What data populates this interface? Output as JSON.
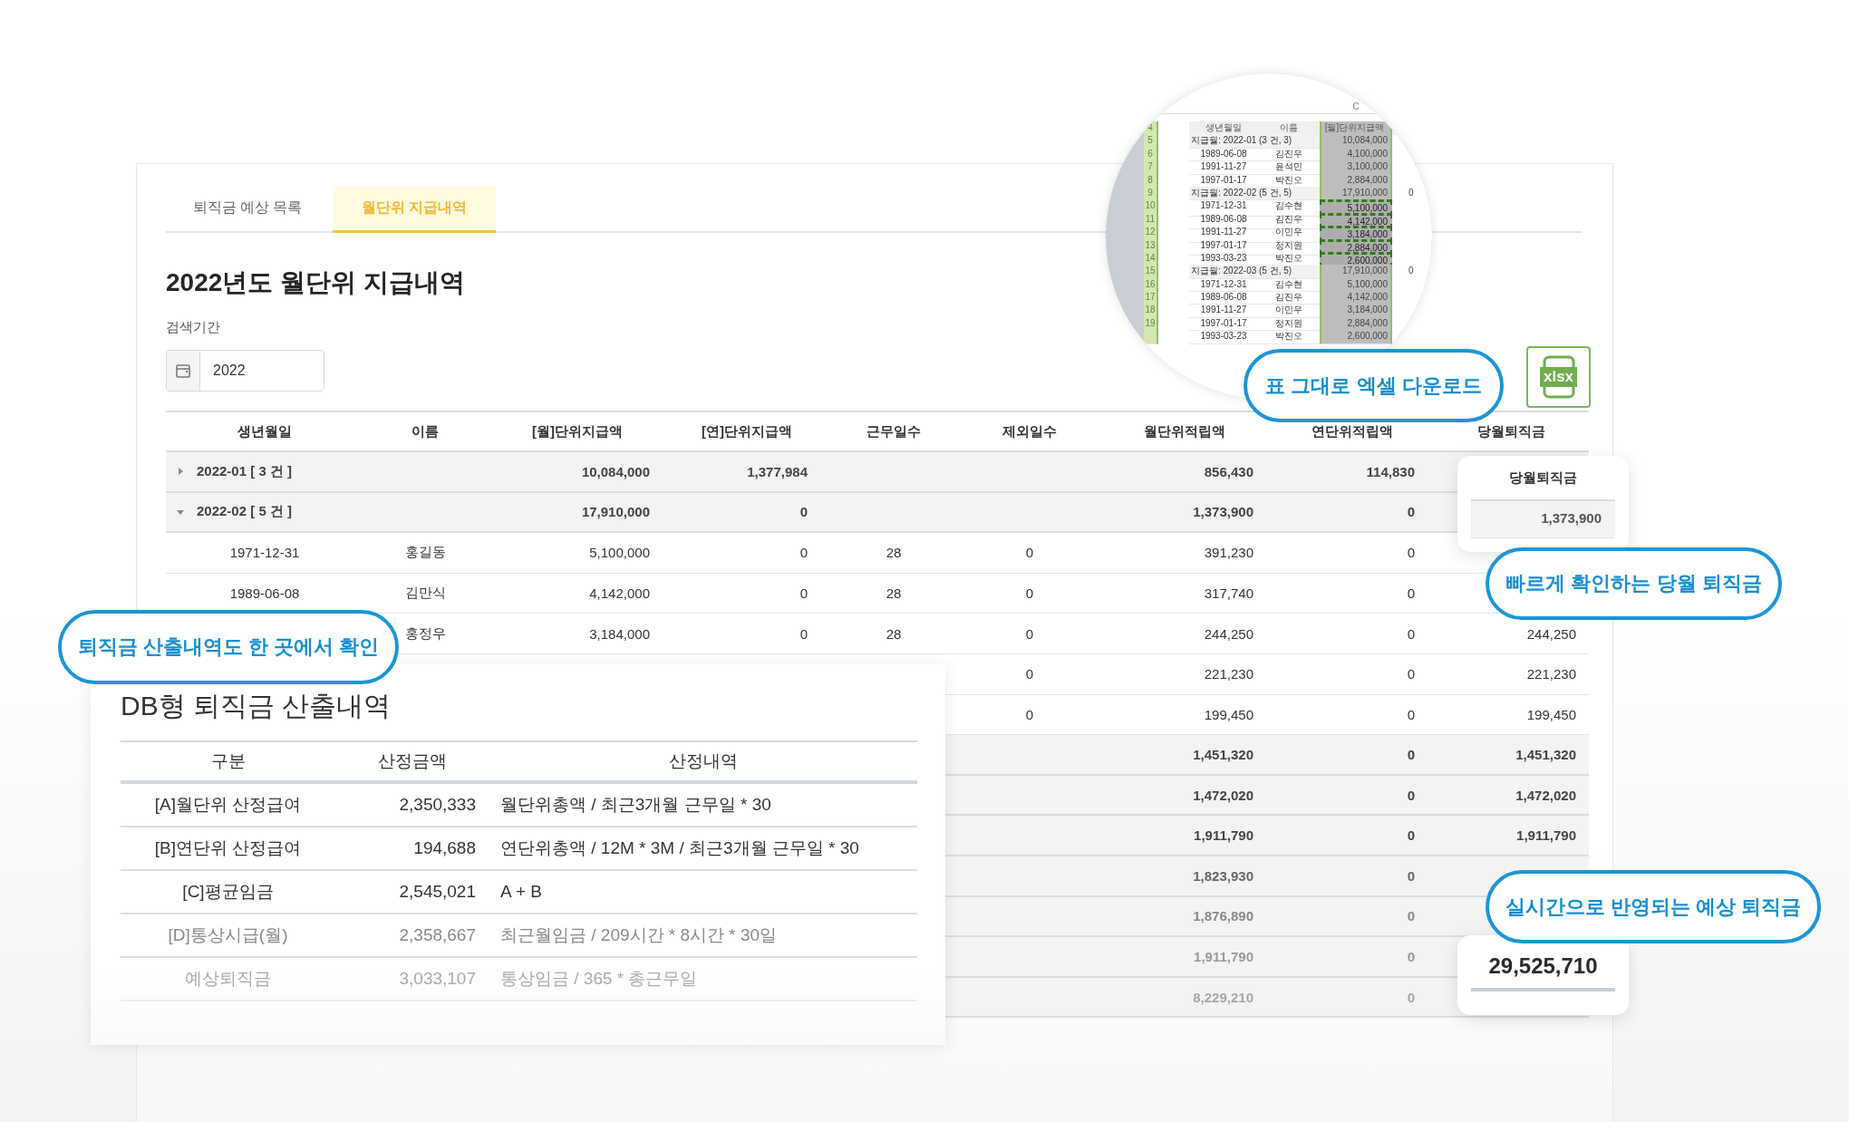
{
  "tabs": [
    {
      "label": "퇴직금 예상 목록",
      "selected": false
    },
    {
      "label": "월단위 지급내역",
      "selected": true
    }
  ],
  "title": "2022년도 월단위 지급내역",
  "search": {
    "label": "검색기간",
    "value": "2022"
  },
  "export_button": {
    "label": "xlsx"
  },
  "table": {
    "columns": [
      "생년월일",
      "이름",
      "[월]단위지급액",
      "[연]단위지급액",
      "근무일수",
      "제외일수",
      "월단위적립액",
      "연단위적립액",
      "당월퇴직금"
    ],
    "rows": [
      {
        "kind": "group",
        "expanded": false,
        "label": "2022-01 [ 3 건 ]",
        "monthly_pay": "10,084,000",
        "yearly_pay": "1,377,984",
        "monthly_reserve": "856,430",
        "yearly_reserve": "114,830"
      },
      {
        "kind": "group",
        "expanded": true,
        "label": "2022-02 [ 5 건 ]",
        "monthly_pay": "17,910,000",
        "yearly_pay": "0",
        "monthly_reserve": "1,373,900",
        "yearly_reserve": "0"
      },
      {
        "kind": "detail",
        "birth": "1971-12-31",
        "name": "홍길동",
        "monthly_pay": "5,100,000",
        "yearly_pay": "0",
        "work_days": "28",
        "excluded_days": "0",
        "monthly_reserve": "391,230",
        "yearly_reserve": "0"
      },
      {
        "kind": "detail",
        "birth": "1989-06-08",
        "name": "김만식",
        "monthly_pay": "4,142,000",
        "yearly_pay": "0",
        "work_days": "28",
        "excluded_days": "0",
        "monthly_reserve": "317,740",
        "yearly_reserve": "0"
      },
      {
        "kind": "detail",
        "name": "홍정우",
        "monthly_pay": "3,184,000",
        "yearly_pay": "0",
        "work_days": "28",
        "excluded_days": "0",
        "monthly_reserve": "244,250",
        "yearly_reserve": "0",
        "month_severance": "244,250"
      },
      {
        "kind": "detail",
        "excluded_days": "0",
        "monthly_reserve": "221,230",
        "yearly_reserve": "0",
        "month_severance": "221,230"
      },
      {
        "kind": "detail",
        "excluded_days": "0",
        "monthly_reserve": "199,450",
        "yearly_reserve": "0",
        "month_severance": "199,450"
      },
      {
        "kind": "group",
        "monthly_reserve": "1,451,320",
        "yearly_reserve": "0",
        "month_severance": "1,451,320"
      },
      {
        "kind": "group",
        "monthly_reserve": "1,472,020",
        "yearly_reserve": "0",
        "month_severance": "1,472,020"
      },
      {
        "kind": "group",
        "monthly_reserve": "1,911,790",
        "yearly_reserve": "0",
        "month_severance": "1,911,790"
      },
      {
        "kind": "group",
        "monthly_reserve": "1,823,930",
        "yearly_reserve": "0"
      },
      {
        "kind": "group",
        "monthly_reserve": "1,876,890",
        "yearly_reserve": "0"
      },
      {
        "kind": "group",
        "monthly_reserve": "1,911,790",
        "yearly_reserve": "0"
      },
      {
        "kind": "group",
        "monthly_reserve": "8,229,210",
        "yearly_reserve": "0"
      }
    ]
  },
  "spreadsheet": {
    "column_letter": "C",
    "rows": [
      {
        "number": "4",
        "kind": "header",
        "selected": false,
        "cells": [
          "생년월일",
          "이름",
          "[월]단위지급액"
        ]
      },
      {
        "number": "5",
        "kind": "group",
        "selected": false,
        "cells": [
          "지급월: 2022-01 (3 건, 3)",
          "10,084,000"
        ]
      },
      {
        "number": "6",
        "kind": "detail",
        "selected": false,
        "cells": [
          "1989-06-08",
          "김진우",
          "4,100,000"
        ]
      },
      {
        "number": "7",
        "kind": "detail",
        "selected": false,
        "cells": [
          "1991-11-27",
          "윤석민",
          "3,100,000"
        ]
      },
      {
        "number": "8",
        "kind": "detail",
        "selected": false,
        "cells": [
          "1997-01-17",
          "박진오",
          "2,884,000"
        ]
      },
      {
        "number": "9",
        "kind": "group",
        "selected": false,
        "cells": [
          "지급월: 2022-02 (5 건, 5)",
          "17,910,000",
          "0"
        ]
      },
      {
        "number": "10",
        "kind": "detail",
        "selected": true,
        "cells": [
          "1971-12-31",
          "김수현",
          "5,100,000"
        ]
      },
      {
        "number": "11",
        "kind": "detail",
        "selected": true,
        "cells": [
          "1989-06-08",
          "김진우",
          "4,142,000"
        ]
      },
      {
        "number": "12",
        "kind": "detail",
        "selected": true,
        "cells": [
          "1991-11-27",
          "이민우",
          "3,184,000"
        ]
      },
      {
        "number": "13",
        "kind": "detail",
        "selected": true,
        "cells": [
          "1997-01-17",
          "정지원",
          "2,884,000"
        ]
      },
      {
        "number": "14",
        "kind": "detail",
        "selected": true,
        "cells": [
          "1993-03-23",
          "박진오",
          "2,600,000"
        ]
      },
      {
        "number": "15",
        "kind": "group",
        "selected": false,
        "cells": [
          "지급월: 2022-03 (5 건, 5)",
          "17,910,000",
          "0"
        ]
      },
      {
        "number": "16",
        "kind": "detail",
        "selected": false,
        "cells": [
          "1971-12-31",
          "김수현",
          "5,100,000"
        ]
      },
      {
        "number": "17",
        "kind": "detail",
        "selected": false,
        "cells": [
          "1989-06-08",
          "김진우",
          "4,142,000"
        ]
      },
      {
        "number": "18",
        "kind": "detail",
        "selected": false,
        "cells": [
          "1991-11-27",
          "이민우",
          "3,184,000"
        ]
      },
      {
        "number": "19",
        "kind": "detail",
        "selected": false,
        "cells": [
          "1997-01-17",
          "정지원",
          "2,884,000"
        ]
      },
      {
        "kind": "detail",
        "selected": false,
        "cells": [
          "1993-03-23",
          "박진오",
          "2,600,000"
        ]
      }
    ]
  },
  "month_card": {
    "header": "당월퇴직금",
    "value": "1,373,900"
  },
  "db_panel": {
    "title": "DB형 퇴직금 산출내역",
    "columns": [
      "구분",
      "산정금액",
      "산정내역"
    ],
    "rows": [
      {
        "label": "[A]월단위 산정급여",
        "amount": "2,350,333",
        "formula": "월단위총액 / 최근3개월 근무일 * 30"
      },
      {
        "label": "[B]연단위 산정급여",
        "amount": "194,688",
        "formula": "연단위총액 / 12M * 3M / 최근3개월 근무일 * 30"
      },
      {
        "label": "[C]평균임금",
        "amount": "2,545,021",
        "formula": "A + B"
      },
      {
        "label": "[D]통상시급(월)",
        "amount": "2,358,667",
        "formula": "최근월임금 / 209시간 * 8시간 * 30일"
      },
      {
        "label": "예상퇴직금",
        "amount": "3,033,107",
        "formula": "통상임금 / 365 * 총근무일"
      }
    ]
  },
  "total_card": {
    "value": "29,525,710"
  },
  "callouts": [
    {
      "text": "표 그대로 엑셀 다운로드"
    },
    {
      "text": "빠르게 확인하는 당월 퇴직금"
    },
    {
      "text": "퇴직금 산출내역도 한 곳에서 확인"
    },
    {
      "text": "실시간으로 반영되는 예상 퇴직금"
    }
  ]
}
